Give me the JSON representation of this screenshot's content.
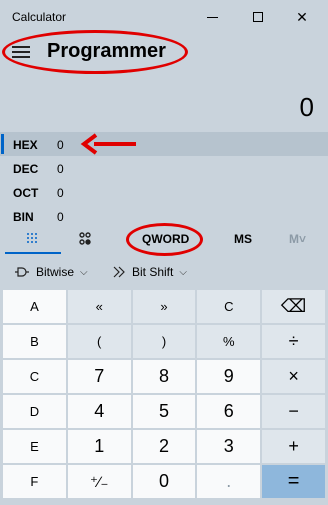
{
  "window": {
    "title": "Calculator",
    "minimize_label": "—",
    "maximize_label": "",
    "close_label": "✕"
  },
  "header": {
    "mode": "Programmer"
  },
  "display": {
    "value": "0"
  },
  "radix": [
    {
      "label": "HEX",
      "value": "0",
      "active": true
    },
    {
      "label": "DEC",
      "value": "0"
    },
    {
      "label": "OCT",
      "value": "0"
    },
    {
      "label": "BIN",
      "value": "0"
    }
  ],
  "modebar": {
    "keypad_icon": "keypad-grid-icon",
    "bitflip_icon": "bit-toggle-icon",
    "word_size": "QWORD",
    "ms": "MS",
    "mplus": "M˅"
  },
  "options": {
    "bitwise": "Bitwise",
    "bitshift": "Bit Shift"
  },
  "keys": [
    [
      "A",
      "«",
      "»",
      "C",
      "⌫"
    ],
    [
      "B",
      "(",
      ")",
      "%",
      "÷"
    ],
    [
      "C",
      "7",
      "8",
      "9",
      "×"
    ],
    [
      "D",
      "4",
      "5",
      "6",
      "−"
    ],
    [
      "E",
      "1",
      "2",
      "3",
      "+"
    ],
    [
      "F",
      "⁺∕₋",
      "0",
      ".",
      "="
    ]
  ],
  "colors": {
    "accent": "#0064c8",
    "annotation": "#e00000",
    "equals_key": "#8eb7dc"
  }
}
